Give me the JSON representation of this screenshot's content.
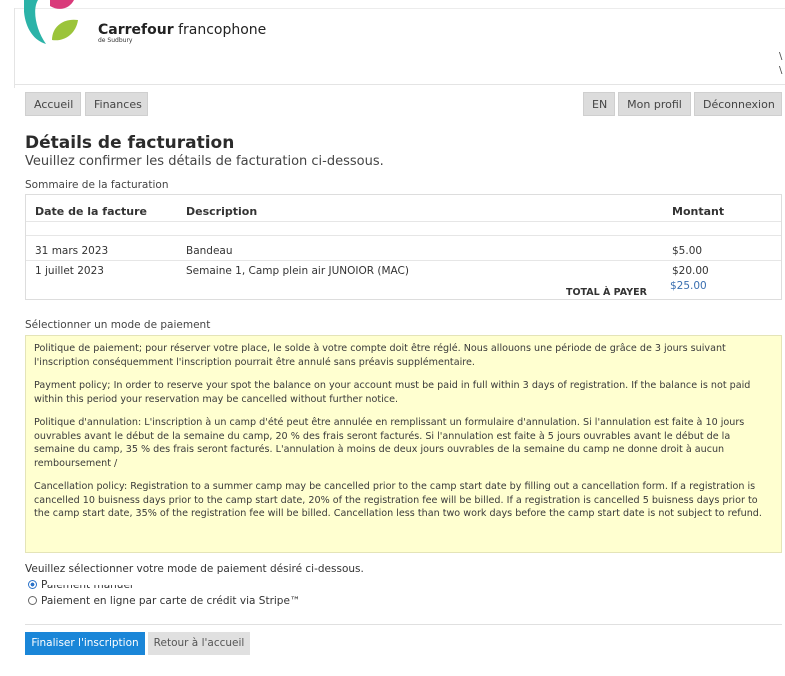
{
  "brand": {
    "name_bold": "Carrefour",
    "name_rest": "francophone",
    "sub": "de Sudbury",
    "colors": {
      "teal": "#2bb3a8",
      "pink": "#d93a7a",
      "green": "#9bc43a"
    }
  },
  "header": {
    "edge_chars": [
      "\\",
      "\\"
    ]
  },
  "nav": {
    "home": "Accueil",
    "finances": "Finances",
    "lang": "EN",
    "profile": "Mon profil",
    "logout": "Déconnexion"
  },
  "page": {
    "title": "Détails de facturation",
    "subtitle": "Veuillez confirmer les détails de facturation ci-dessous."
  },
  "billing": {
    "label": "Sommaire de la facturation",
    "headers": {
      "date": "Date de la facture",
      "description": "Description",
      "amount": "Montant"
    },
    "rows": [
      {
        "date": "31 mars 2023",
        "description": "Bandeau",
        "amount": "$5.00"
      },
      {
        "date": "1 juillet 2023",
        "description": "Semaine 1, Camp plein air JUNOIOR (MAC)",
        "amount": "$20.00"
      }
    ],
    "total_label": "TOTAL À PAYER",
    "total_value": "$25.00"
  },
  "payment": {
    "label": "Sélectionner un mode de paiement",
    "policy": [
      "Politique de paiement; pour réserver votre place, le solde à votre compte doit être réglé. Nous allouons une période de grâce de 3 jours suivant l'inscription conséquemment l'inscription pourrait être annulé sans préavis supplémentaire.",
      "Payment policy; In order to reserve your spot the balance on your account must be paid in full within 3 days of registration. If the balance is not paid within this period your reservation may be cancelled without further notice.",
      "Politique d'annulation: L'inscription à un camp d'été peut être annulée en remplissant un formulaire d'annulation. Si l'annulation est faite à 10 jours ouvrables avant le début de la semaine du camp, 20 % des frais seront facturés. Si l'annulation est faite à 5 jours ouvrables avant le début de la semaine du camp, 35 % des frais seront facturés. L'annulation à moins de deux jours ouvrables de la semaine du camp ne donne droit à aucun remboursement /",
      "Cancellation policy: Registration to a summer camp may be cancelled prior to the camp start date by filling out a cancellation form. If a registration is cancelled 10 buisness days prior to the camp start date, 20% of the registration fee will be billed. If a registration is cancelled 5 buisness days prior to the camp start date, 35% of the registration fee will be billed. Cancellation less than two work days before the camp start date is not subject to refund."
    ],
    "choose_text": "Veuillez sélectionner votre mode de paiement désiré ci-dessous.",
    "option_manual": "Paiement manuel",
    "option_stripe": "Paiement en ligne par carte de crédit via Stripe™"
  },
  "actions": {
    "finalize": "Finaliser l'inscription",
    "back": "Retour à l'accueil"
  }
}
